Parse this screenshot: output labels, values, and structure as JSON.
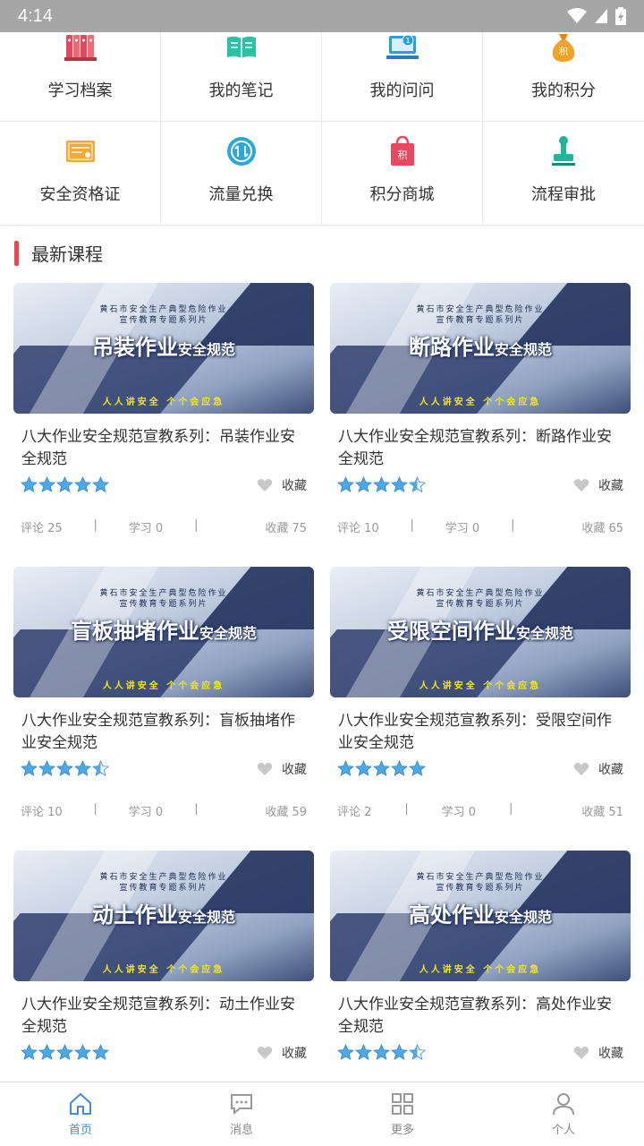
{
  "status_bar": {
    "time": "4:14"
  },
  "grid": [
    {
      "label": "学习档案",
      "icon": "file-binders-icon",
      "color": "#e24a5b"
    },
    {
      "label": "我的笔记",
      "icon": "open-book-icon",
      "color": "#2bc1a8"
    },
    {
      "label": "我的问问",
      "icon": "computer-question-icon",
      "color": "#2b9ee0"
    },
    {
      "label": "我的积分",
      "icon": "money-bag-icon",
      "color": "#f0a22a"
    },
    {
      "label": "安全资格证",
      "icon": "certificate-icon",
      "color": "#f2a93b"
    },
    {
      "label": "流量兑换",
      "icon": "exchange-icon",
      "color": "#2ba8d8"
    },
    {
      "label": "积分商城",
      "icon": "shopping-bag-icon",
      "color": "#e84860"
    },
    {
      "label": "流程审批",
      "icon": "stamp-icon",
      "color": "#22b39a"
    }
  ],
  "section": {
    "title": "最新课程"
  },
  "thumb_text": {
    "sub1": "黄石市安全生产典型危险作业",
    "sub2": "宣传教育专题系列片",
    "suffix": "安全规范",
    "slogan": "人人讲安全 个个会应急"
  },
  "courses": [
    {
      "thumb_main": "吊装作业",
      "title": "八大作业安全规范宣教系列：吊装作业安全规范",
      "rating": 5,
      "fav_label": "收藏",
      "comments": "评论 25",
      "study": "学习 0",
      "favs": "收藏 75"
    },
    {
      "thumb_main": "断路作业",
      "title": "八大作业安全规范宣教系列：断路作业安全规范",
      "rating": 4.5,
      "fav_label": "收藏",
      "comments": "评论 10",
      "study": "学习 0",
      "favs": "收藏 65"
    },
    {
      "thumb_main": "盲板抽堵作业",
      "title": "八大作业安全规范宣教系列：盲板抽堵作业安全规范",
      "rating": 4.5,
      "fav_label": "收藏",
      "comments": "评论 10",
      "study": "学习 0",
      "favs": "收藏 59"
    },
    {
      "thumb_main": "受限空间作业",
      "title": "八大作业安全规范宣教系列：受限空间作业安全规范",
      "rating": 5,
      "fav_label": "收藏",
      "comments": "评论 2",
      "study": "学习 0",
      "favs": "收藏 51"
    },
    {
      "thumb_main": "动土作业",
      "title": "八大作业安全规范宣教系列：动土作业安全规范",
      "rating": 5,
      "fav_label": "收藏",
      "comments": "",
      "study": "",
      "favs": ""
    },
    {
      "thumb_main": "高处作业",
      "title": "八大作业安全规范宣教系列：高处作业安全规范",
      "rating": 4.5,
      "fav_label": "收藏",
      "comments": "",
      "study": "",
      "favs": ""
    }
  ],
  "tabs": [
    {
      "label": "首页",
      "icon": "home-icon",
      "active": true
    },
    {
      "label": "消息",
      "icon": "message-icon",
      "active": false
    },
    {
      "label": "更多",
      "icon": "grid-icon",
      "active": false
    },
    {
      "label": "个人",
      "icon": "person-icon",
      "active": false
    }
  ],
  "colors": {
    "accent": "#3d8fd8",
    "section_bar": "#e8474c",
    "star": "#4ea8e6"
  }
}
